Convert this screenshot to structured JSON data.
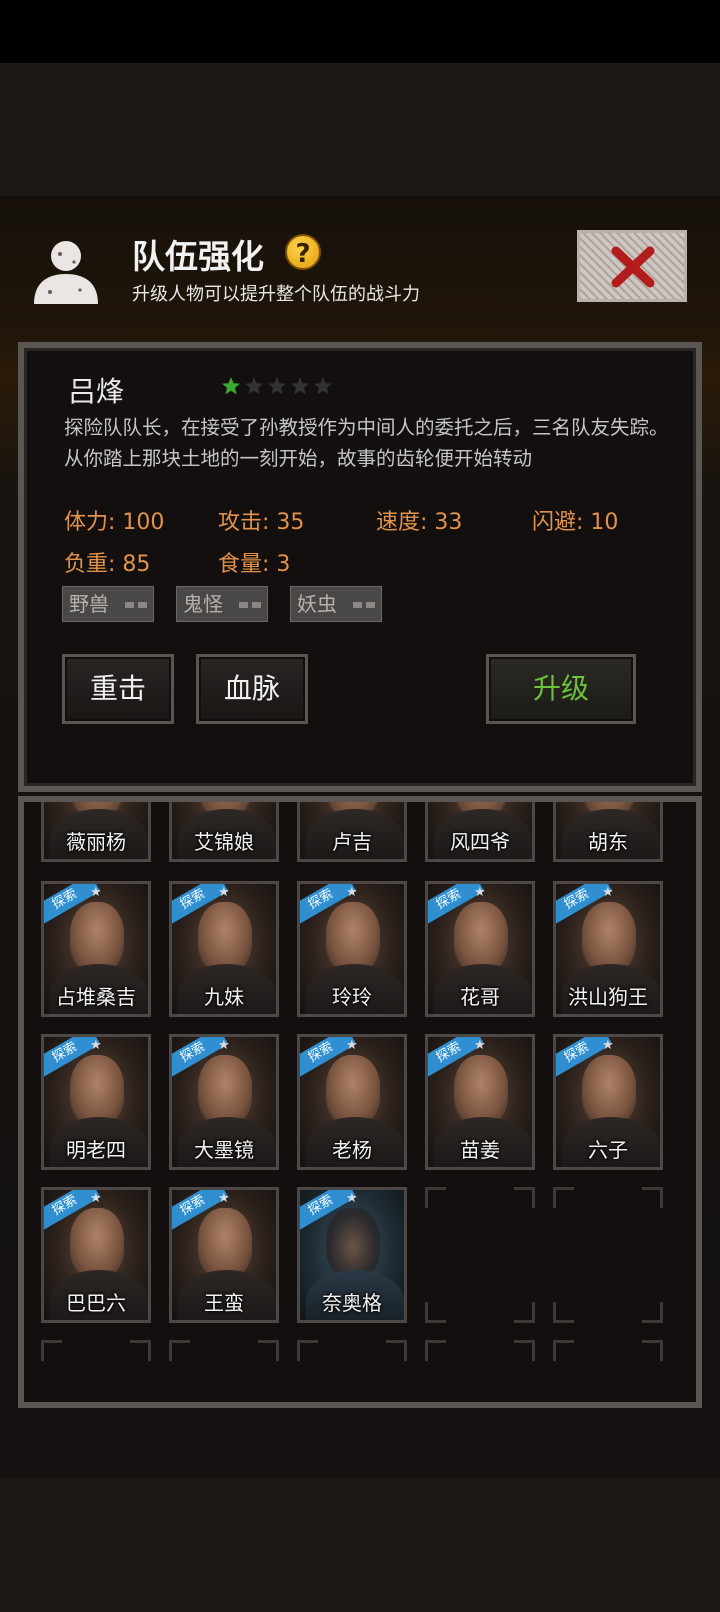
{
  "header": {
    "title": "队伍强化",
    "help_glyph": "?",
    "subtitle": "升级人物可以提升整个队伍的战斗力"
  },
  "character": {
    "name": "吕烽",
    "stars_filled": 1,
    "stars_total": 5,
    "description": "探险队队长，在接受了孙教授作为中间人的委托之后，三名队友失踪。从你踏上那块土地的一刻开始，故事的齿轮便开始转动",
    "stats": {
      "stamina": "体力: 100",
      "attack": "攻击: 35",
      "speed": "速度: 33",
      "dodge": "闪避: 10",
      "load": "负重: 85",
      "food": "食量: 3"
    },
    "tags": [
      "野兽",
      "鬼怪",
      "妖虫"
    ]
  },
  "buttons": {
    "skill1": "重击",
    "skill2": "血脉",
    "upgrade": "升级"
  },
  "roster": {
    "top_row": [
      "薇丽杨",
      "艾锦娘",
      "卢吉",
      "风四爷",
      "胡东"
    ],
    "explore_badge": "探索",
    "star_glyph": "★",
    "rows": [
      [
        "占堆桑吉",
        "九妹",
        "玲玲",
        "花哥",
        "洪山狗王"
      ],
      [
        "明老四",
        "大墨镜",
        "老杨",
        "苗姜",
        "六子"
      ],
      [
        "巴巴六",
        "王蛮",
        "奈奥格"
      ]
    ]
  },
  "colors": {
    "stat_orange": "#e2924a",
    "upgrade_green": "#6cc23a",
    "badge_blue": "#2f8fd0",
    "star_green": "#3aa832"
  }
}
